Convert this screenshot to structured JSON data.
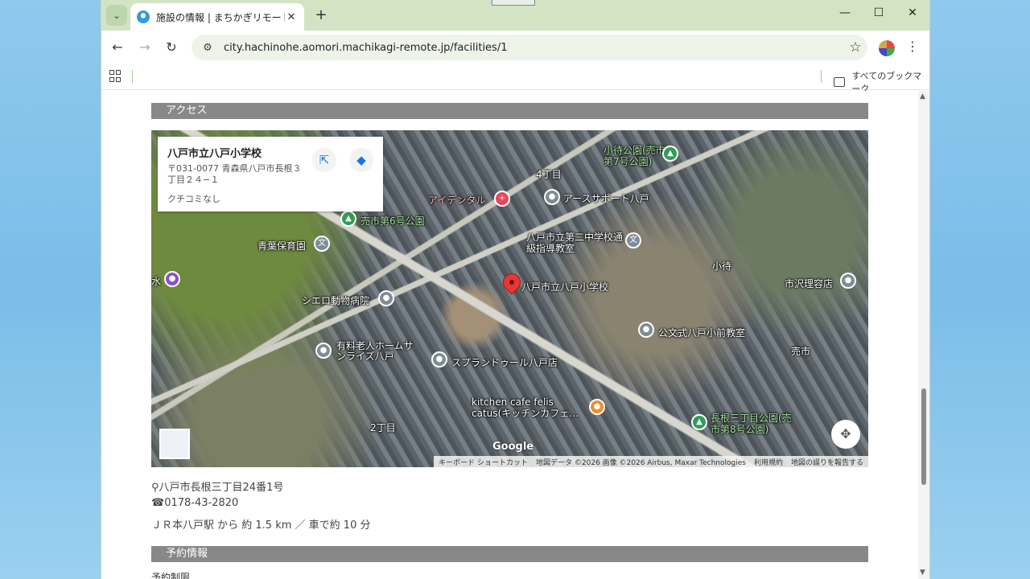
{
  "browser": {
    "tab_title": "施設の情報 | まちかぎリモート",
    "new_tab": "+",
    "url": "city.hachinohe.aomori.machikagi-remote.jp/facilities/1",
    "all_bookmarks": "すべてのブックマーク"
  },
  "sections": {
    "access": "アクセス",
    "reservation": "予約情報",
    "reservation_sub": "予約制限"
  },
  "map": {
    "infocard": {
      "name": "八戸市立八戸小学校",
      "address": "〒031-0077 青森県八戸市長根３丁目２４−１",
      "reviews": "クチコミなし"
    },
    "labels": [
      {
        "text": "アイデンタル",
        "style": "red",
        "icon": "red"
      },
      {
        "text": "4丁目",
        "style": "plain"
      },
      {
        "text": "アースサポート八戸",
        "style": "plain",
        "icon": "gray"
      },
      {
        "text": "小待公園(売市第7号公園)",
        "style": "green",
        "icon": "green"
      },
      {
        "text": "売市第6号公園",
        "style": "green",
        "icon": "green"
      },
      {
        "text": "青葉保育園",
        "style": "plain",
        "icon": "gray"
      },
      {
        "text": "八戸市立第二中学校通級指導教室",
        "style": "plain",
        "icon": "gray"
      },
      {
        "text": "八戸市立八戸小学校",
        "style": "plain"
      },
      {
        "text": "小待",
        "style": "plain"
      },
      {
        "text": "市沢理容店",
        "style": "plain",
        "icon": "gray"
      },
      {
        "text": "水",
        "style": "plain",
        "icon": "purple"
      },
      {
        "text": "シエロ動物病院",
        "style": "plain",
        "icon": "gray"
      },
      {
        "text": "公文式八戸小前教室",
        "style": "plain",
        "icon": "gray"
      },
      {
        "text": "有料老人ホームサンライズ八戸",
        "style": "plain",
        "icon": "gray"
      },
      {
        "text": "売市",
        "style": "plain"
      },
      {
        "text": "スプランドゥール八戸店",
        "style": "plain",
        "icon": "gray"
      },
      {
        "text": "kitchen cafe felis catus(キッチンカフェ…",
        "style": "plain",
        "icon": "orange"
      },
      {
        "text": "長根三丁目公園(売市第8号公園)",
        "style": "green",
        "icon": "green"
      },
      {
        "text": "2丁目",
        "style": "plain"
      }
    ],
    "google": "Google",
    "attribution": [
      "キーボード ショートカット",
      "地図データ ©2026 画像 ©2026 Airbus, Maxar Technologies",
      "利用規約",
      "地図の誤りを報告する"
    ]
  },
  "facility": {
    "address": "八戸市長根三丁目24番1号",
    "phone": "0178-43-2820",
    "access": "ＪＲ本八戸駅 から 約 1.5 km ／ 車で約 10 分"
  }
}
